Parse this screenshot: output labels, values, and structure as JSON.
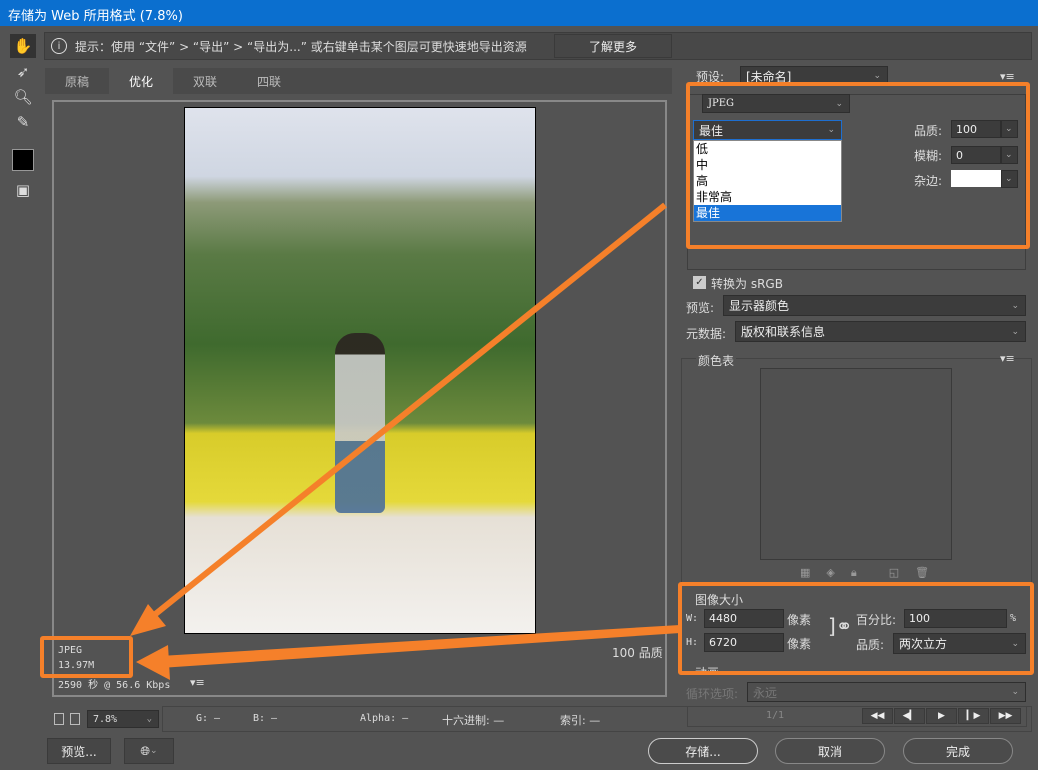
{
  "window": {
    "title": "存储为 Web 所用格式 (7.8%)"
  },
  "hint": {
    "text": "提示：使用 “文件” > “导出” > “导出为...” 或右键单击某个图层可更快速地导出资源",
    "learn_more": "了解更多"
  },
  "tabs": [
    "原稿",
    "优化",
    "双联",
    "四联"
  ],
  "preview_info": {
    "format": "JPEG",
    "size": "13.97M",
    "time": "2590 秒 @ 56.6 Kbps",
    "quality": "100 品质"
  },
  "status": {
    "zoom": "7.8%",
    "g": "G: —",
    "b": "B: —",
    "alpha": "Alpha: —",
    "hex": "十六进制: —",
    "index": "索引: —"
  },
  "bottom": {
    "preview": "预览...",
    "save": "存储...",
    "cancel": "取消",
    "done": "完成"
  },
  "settings": {
    "preset_label": "预设:",
    "preset_value": "[未命名]",
    "format": "JPEG",
    "quality_preset": "最佳",
    "quality_options": [
      "低",
      "中",
      "高",
      "非常高",
      "最佳"
    ],
    "quality_label": "品质:",
    "quality_value": "100",
    "blur_label": "模糊:",
    "blur_value": "0",
    "matte_label": "杂边:",
    "convert_srgb": "转换为 sRGB",
    "preview_label": "预览:",
    "preview_value": "显示器颜色",
    "metadata_label": "元数据:",
    "metadata_value": "版权和联系信息"
  },
  "color_table": {
    "title": "颜色表"
  },
  "image_size": {
    "title": "图像大小",
    "w_label": "W:",
    "w_value": "4480",
    "h_label": "H:",
    "h_value": "6720",
    "unit": "像素",
    "percent_label": "百分比:",
    "percent_value": "100",
    "percent_sign": "%",
    "quality_label": "品质:",
    "quality_value": "两次立方"
  },
  "animation": {
    "title": "动画",
    "loop_label": "循环选项:",
    "loop_value": "永远",
    "frame": "1/1"
  },
  "colors": {
    "accent": "#f5802a",
    "titlebar": "#0b6fcf"
  }
}
